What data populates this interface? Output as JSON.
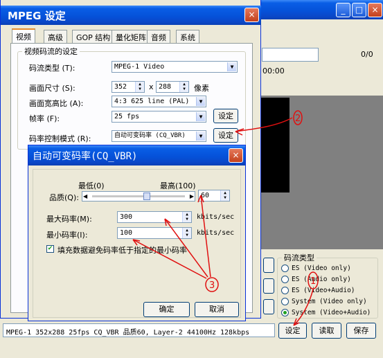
{
  "main_window": {
    "counter": "0/0",
    "time": "00:00",
    "stream_type_group": "码流类型",
    "stream_types": [
      {
        "label": "ES (Video only)",
        "selected": false
      },
      {
        "label": "ES (Audio only)",
        "selected": false
      },
      {
        "label": "ES (Video+Audio)",
        "selected": false
      },
      {
        "label": "System (Video only)",
        "selected": false
      },
      {
        "label": "System (Video+Audio)",
        "selected": true
      }
    ],
    "buttons": {
      "settings": "设定",
      "load": "读取",
      "save": "保存"
    },
    "status_bar": "MPEG-1 352x288 25fps CQ_VBR 品质60,  Layer-2 44100Hz 128kbps"
  },
  "settings_dialog": {
    "title": "MPEG 设定",
    "tabs": [
      "视频",
      "高级",
      "GOP 结构",
      "量化矩阵",
      "音频",
      "系统"
    ],
    "group_label": "视频码流的设定",
    "stream_type_label": "码流类型 (T):",
    "stream_type_value": "MPEG-1 Video",
    "frame_size_label": "画面尺寸 (S):",
    "width": "352",
    "x_sep": "x",
    "height": "288",
    "pixel_unit": "像素",
    "aspect_label": "画面宽高比 (A):",
    "aspect_value": "4:3 625 line (PAL)",
    "fps_label": "帧率 (F):",
    "fps_value": "25 fps",
    "fps_button": "设定",
    "rate_mode_label": "码率控制模式 (R):",
    "rate_mode_value": "自动可变码率 (CQ_VBR)",
    "rate_mode_button": "设定"
  },
  "vbr_dialog": {
    "title": "自动可变码率(CQ_VBR)",
    "slider_min_label": "最低(0)",
    "slider_max_label": "最高(100)",
    "quality_label": "品质(Q):",
    "quality_value": "60",
    "quality_fraction": 0.6,
    "max_rate_label": "最大码率(M):",
    "max_rate_value": "300",
    "max_rate_unit": "kbits/sec",
    "min_rate_label": "最小码率(I):",
    "min_rate_value": "100",
    "min_rate_unit": "kbits/sec",
    "fill_checkbox_label": "填充数据避免码率低于指定的最小码率",
    "fill_checked": true,
    "ok_button": "确定",
    "cancel_button": "取消"
  },
  "annotations": {
    "mark_1": "1",
    "mark_2": "2",
    "mark_3": "3"
  }
}
